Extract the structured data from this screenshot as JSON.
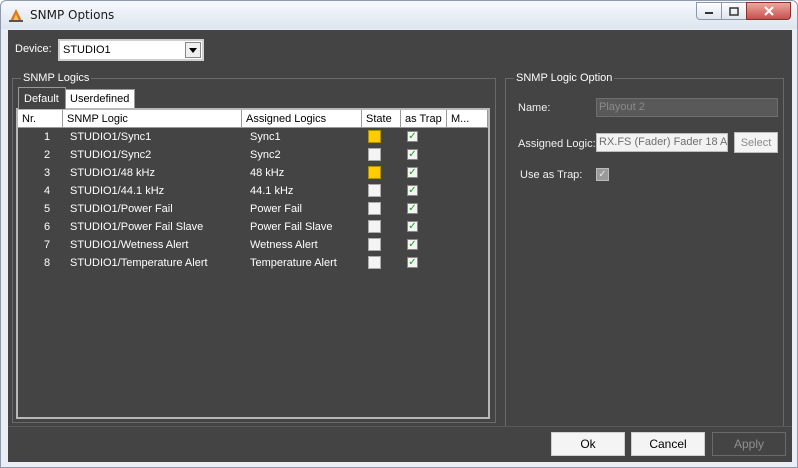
{
  "window": {
    "title": "SNMP Options"
  },
  "device": {
    "label": "Device:",
    "value": "STUDIO1"
  },
  "snmp_logics": {
    "group_title": "SNMP Logics",
    "tabs": [
      "Default",
      "Userdefined"
    ],
    "columns": [
      "Nr.",
      "SNMP Logic",
      "Assigned Logics",
      "State",
      "as Trap",
      "M..."
    ],
    "rows": [
      {
        "nr": "1",
        "logic": "STUDIO1/Sync1",
        "assigned": "Sync1",
        "state_on": true,
        "trap": true
      },
      {
        "nr": "2",
        "logic": "STUDIO1/Sync2",
        "assigned": "Sync2",
        "state_on": false,
        "trap": true
      },
      {
        "nr": "3",
        "logic": "STUDIO1/48 kHz",
        "assigned": "48 kHz",
        "state_on": true,
        "trap": true
      },
      {
        "nr": "4",
        "logic": "STUDIO1/44.1 kHz",
        "assigned": "44.1 kHz",
        "state_on": false,
        "trap": true
      },
      {
        "nr": "5",
        "logic": "STUDIO1/Power Fail",
        "assigned": "Power Fail",
        "state_on": false,
        "trap": true
      },
      {
        "nr": "6",
        "logic": "STUDIO1/Power Fail Slave",
        "assigned": "Power Fail Slave",
        "state_on": false,
        "trap": true
      },
      {
        "nr": "7",
        "logic": "STUDIO1/Wetness Alert",
        "assigned": "Wetness Alert",
        "state_on": false,
        "trap": true
      },
      {
        "nr": "8",
        "logic": "STUDIO1/Temperature Alert",
        "assigned": "Temperature Alert",
        "state_on": false,
        "trap": true
      }
    ]
  },
  "logic_option": {
    "group_title": "SNMP Logic Option",
    "name_label": "Name:",
    "name_value": "Playout 2",
    "assigned_label": "Assigned Logic:",
    "assigned_value": "RX.FS (Fader) Fader 18 A",
    "select_label": "Select",
    "trap_label": "Use as Trap:",
    "trap_checked": true
  },
  "buttons": {
    "ok": "Ok",
    "cancel": "Cancel",
    "apply": "Apply"
  },
  "colors": {
    "state_on": "#ffcc00",
    "background": "#444444"
  },
  "icons": [
    "app-icon",
    "minimize-icon",
    "maximize-icon",
    "close-icon",
    "dropdown-arrow-icon",
    "checkmark-icon"
  ]
}
